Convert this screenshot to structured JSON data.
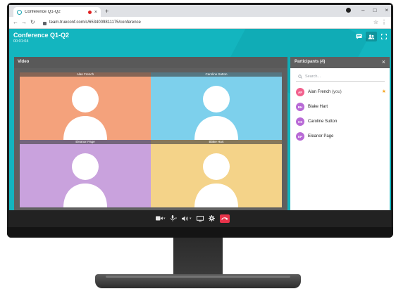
{
  "browser": {
    "tab_title": "Conference Q1-Q2",
    "tab_close": "×",
    "new_tab": "+",
    "url": "team.trueconf.com/c/6534009811175/conference",
    "window_controls": [
      "–",
      "□",
      "×"
    ]
  },
  "app": {
    "conference_title": "Conference Q1-Q2",
    "timer": "00:01:04",
    "header_icons": [
      "chat-icon",
      "participants-icon",
      "fullscreen-icon"
    ],
    "accent_color": "#13b5bf"
  },
  "video": {
    "panel_title": "Video",
    "tiles": [
      {
        "name": "Alan French",
        "color": "#f4a27c"
      },
      {
        "name": "Caroline Sutton",
        "color": "#7dd0ec"
      },
      {
        "name": "Eleanor Page",
        "color": "#c9a2dd"
      },
      {
        "name": "Blake Hart",
        "color": "#f4d389"
      }
    ]
  },
  "participants": {
    "title": "Participants (4)",
    "search_placeholder": "Search...",
    "items": [
      {
        "initials": "AF",
        "name": "Alan French",
        "suffix": "(you)",
        "owner": true
      },
      {
        "initials": "BH",
        "name": "Blake Hart",
        "suffix": "",
        "owner": false
      },
      {
        "initials": "CS",
        "name": "Caroline Sutton",
        "suffix": "",
        "owner": false
      },
      {
        "initials": "EP",
        "name": "Eleanor Page",
        "suffix": "",
        "owner": false
      }
    ]
  },
  "controls": [
    "camera-icon",
    "microphone-icon",
    "speaker-icon",
    "screen-share-icon",
    "settings-icon",
    "hang-up-icon"
  ]
}
